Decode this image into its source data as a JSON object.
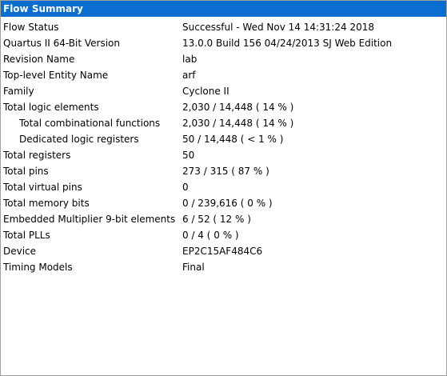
{
  "panel": {
    "title": "Flow Summary"
  },
  "rows": [
    {
      "label": "Flow Status",
      "value": "Successful - Wed Nov 14 14:31:24 2018",
      "indent": false
    },
    {
      "label": "Quartus II 64-Bit Version",
      "value": "13.0.0 Build 156 04/24/2013 SJ Web Edition",
      "indent": false
    },
    {
      "label": "Revision Name",
      "value": "lab",
      "indent": false
    },
    {
      "label": "Top-level Entity Name",
      "value": "arf",
      "indent": false
    },
    {
      "label": "Family",
      "value": "Cyclone II",
      "indent": false
    },
    {
      "label": "Total logic elements",
      "value": "2,030 / 14,448 ( 14 % )",
      "indent": false
    },
    {
      "label": "Total combinational functions",
      "value": "2,030 / 14,448 ( 14 % )",
      "indent": true
    },
    {
      "label": "Dedicated logic registers",
      "value": "50 / 14,448 ( < 1 % )",
      "indent": true
    },
    {
      "label": "Total registers",
      "value": "50",
      "indent": false
    },
    {
      "label": "Total pins",
      "value": "273 / 315 ( 87 % )",
      "indent": false
    },
    {
      "label": "Total virtual pins",
      "value": "0",
      "indent": false
    },
    {
      "label": "Total memory bits",
      "value": "0 / 239,616 ( 0 % )",
      "indent": false
    },
    {
      "label": "Embedded Multiplier 9-bit elements",
      "value": "6 / 52 ( 12 % )",
      "indent": false
    },
    {
      "label": "Total PLLs",
      "value": "0 / 4 ( 0 % )",
      "indent": false
    },
    {
      "label": "Device",
      "value": "EP2C15AF484C6",
      "indent": false
    },
    {
      "label": "Timing Models",
      "value": "Final",
      "indent": false
    }
  ]
}
